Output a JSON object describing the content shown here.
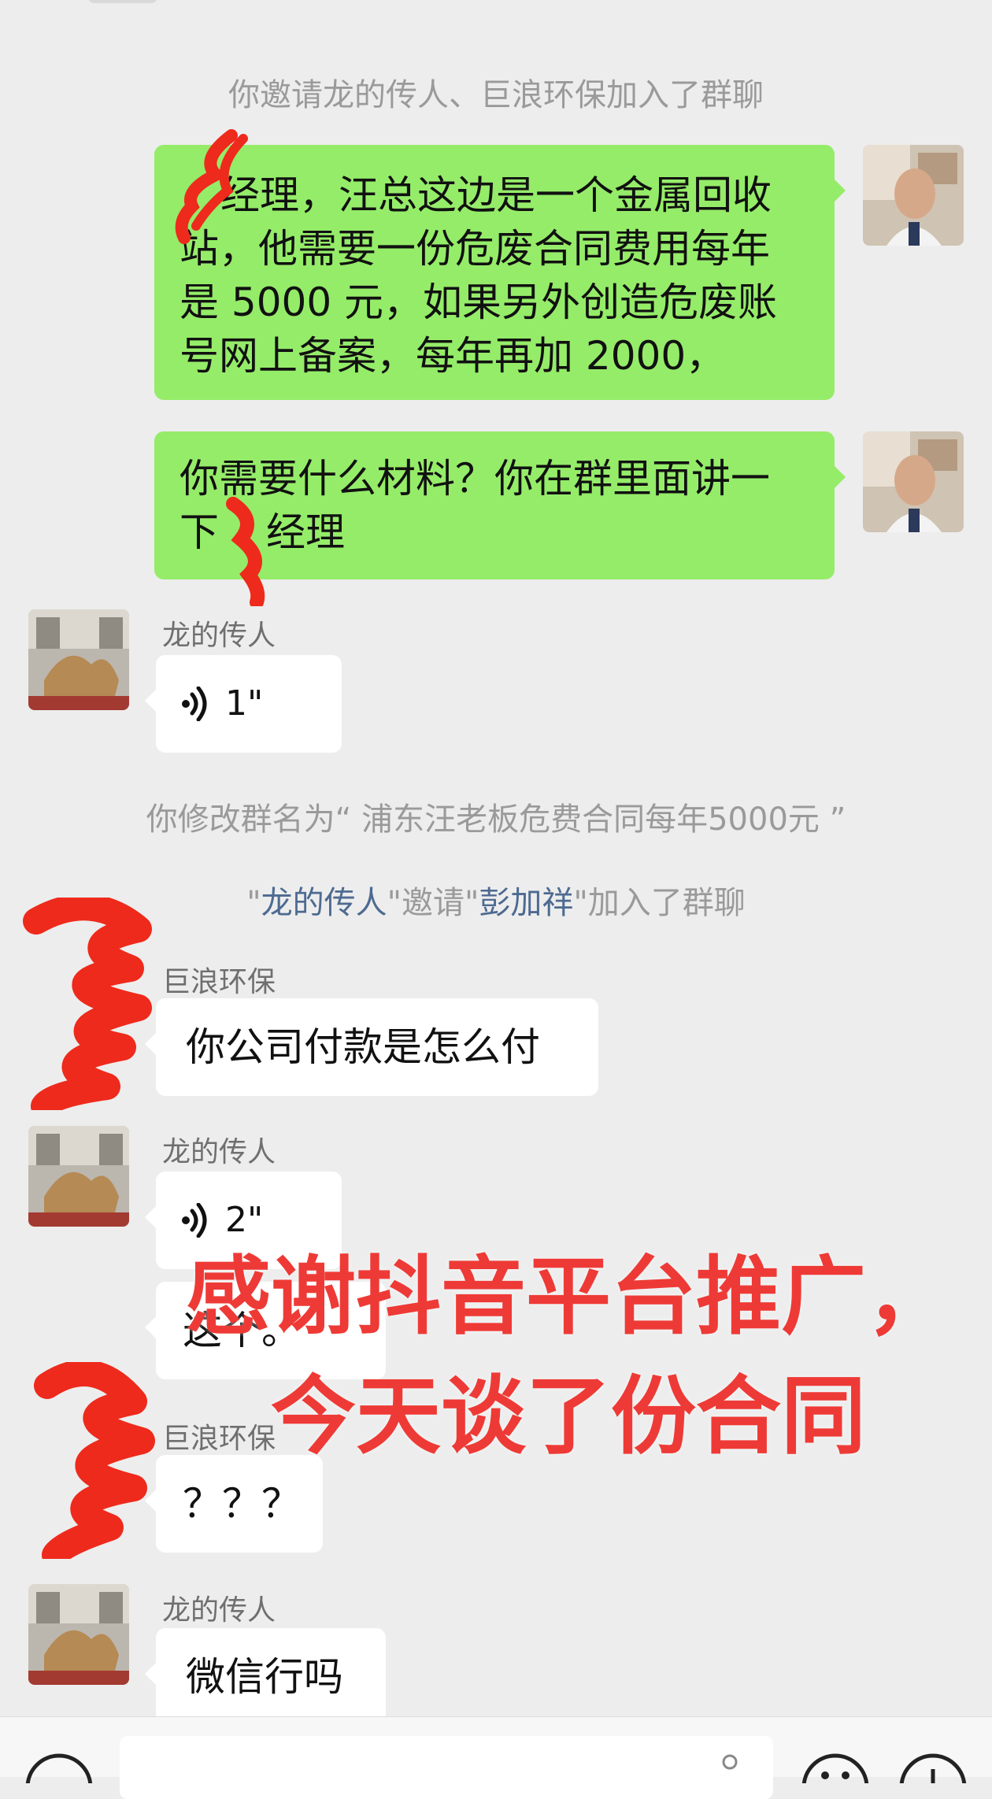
{
  "colors": {
    "background": "#ededed",
    "outgoing_bubble": "#95ec69",
    "incoming_bubble": "#ffffff",
    "system_text": "#9a9a9a",
    "link_name": "#4d6a91",
    "promo_text": "#ee3a36",
    "redaction": "#ee2a1c"
  },
  "chat": {
    "system_invite": "你邀请龙的传人、巨浪环保加入了群聊",
    "msg1": {
      "line1": "经理，汪总这边是一个金属回收",
      "line2": "站，他需要一份危废合同费用每年",
      "line3": "是 5000 元，如果另外创造危废账",
      "line4": "号网上备案，每年再加 2000，"
    },
    "msg2": {
      "line1": "你需要什么材料？你在群里面讲一",
      "line2a": "下",
      "line2b": "经理"
    },
    "sender_long": "龙的传人",
    "sender_julang": "巨浪环保",
    "voice1": "1\"",
    "system_rename": "你修改群名为“ 浦东汪老板危费合同每年5000元 ”",
    "system_invite2": {
      "q1": "\"",
      "inviter": "龙的传人",
      "q2": "\"邀请\"",
      "invitee": "彭加祥",
      "q3": "\"加入了群聊"
    },
    "msg_payment": "你公司付款是怎么付",
    "voice2": "2\"",
    "msg_this": "这个。",
    "msg_question": "？？？",
    "msg_wechat": "微信行吗"
  },
  "overlay": {
    "line1": "感谢抖音平台推广，",
    "line2": "今天谈了份合同"
  },
  "icons": [
    "voice-wave-icon",
    "voice-input-icon",
    "emoji-icon",
    "plus-icon"
  ]
}
